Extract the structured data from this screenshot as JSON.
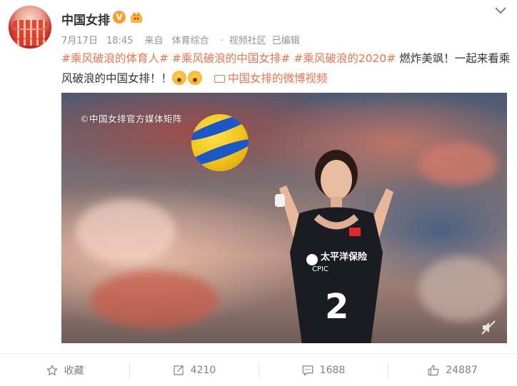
{
  "post": {
    "author": "中国女排",
    "verified_badge": "V",
    "meta": {
      "date": "7月17日",
      "time": "18:45",
      "source_prefix": "来自",
      "source": "体育综合",
      "community": "视频社区",
      "edited": "已编辑"
    },
    "text": {
      "tag1": "#乘风破浪的体育人#",
      "tag2": "#乘风破浪的中国女排#",
      "tag3": "#乘风破浪的2020#",
      "body": " 燃炸美飒！一起来看乘风破浪的中国女排！！",
      "video_link": "中国女排的微博视频"
    },
    "video": {
      "watermark": "©中国女排官方媒体矩阵",
      "jersey_sponsor": "太平洋保险",
      "jersey_sponsor_en": "CPIC",
      "jersey_number": "2"
    },
    "actions": {
      "favorite": "收藏",
      "repost": "4210",
      "comment": "1688",
      "like": "24887"
    }
  },
  "colors": {
    "accent": "#eb7350",
    "meta_text": "#939393",
    "action_text": "#808080",
    "badge": "#ff9d2b"
  },
  "icons": [
    "chevron-down-icon",
    "member-crown-icon",
    "video-icon",
    "mute-icon",
    "star-icon",
    "repost-icon",
    "comment-icon",
    "like-icon"
  ]
}
